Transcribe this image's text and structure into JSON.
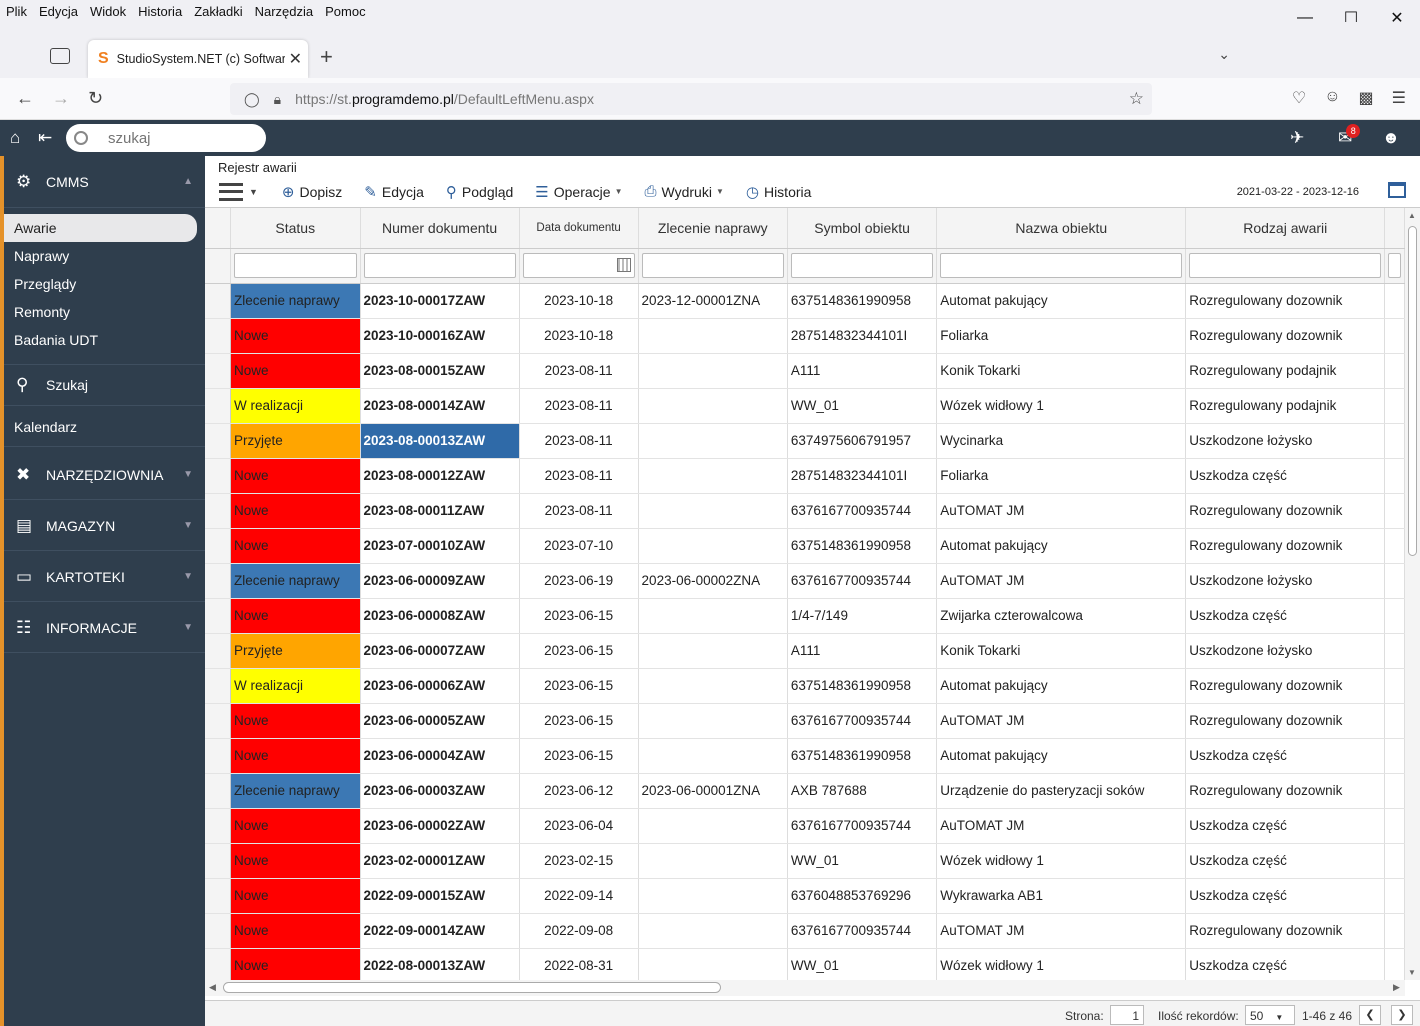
{
  "browser": {
    "menu": [
      "Plik",
      "Edycja",
      "Widok",
      "Historia",
      "Zakładki",
      "Narzędzia",
      "Pomoc"
    ],
    "tab_title": "StudioSystem.NET (c) Software",
    "url_prefix": "https://st.",
    "url_domain": "programdemo.pl",
    "url_path": "/DefaultLeftMenu.aspx"
  },
  "header": {
    "search_placeholder": "szukaj",
    "mail_count": "8"
  },
  "sidebar": {
    "cmms": "CMMS",
    "items": [
      "Awarie",
      "Naprawy",
      "Przeglądy",
      "Remonty",
      "Badania UDT"
    ],
    "szukaj": "Szukaj",
    "kalendarz": "Kalendarz",
    "narzedziownia": "NARZĘDZIOWNIA",
    "magazyn": "MAGAZYN",
    "kartoteki": "KARTOTEKI",
    "informacje": "INFORMACJE"
  },
  "main": {
    "breadcrumb": "Rejestr awarii",
    "toolbar": {
      "dopisz": "Dopisz",
      "edycja": "Edycja",
      "podglad": "Podgląd",
      "operacje": "Operacje",
      "wydruki": "Wydruki",
      "historia": "Historia"
    },
    "date_range": "2021-03-22 - 2023-12-16"
  },
  "grid": {
    "columns": [
      "Status",
      "Numer dokumentu",
      "Data dokumentu",
      "Zlecenie naprawy",
      "Symbol obiektu",
      "Nazwa obiektu",
      "Rodzaj awarii"
    ],
    "status_colors": {
      "Zlecenie naprawy": "#3c78b4",
      "Nowe": "#ff0000",
      "W realizacji": "#ffff00",
      "Przyjęte": "#ffa500"
    },
    "selected_cell_color": "#2f6aa8",
    "rows": [
      {
        "status": "Zlecenie naprawy",
        "doc": "2023-10-00017ZAW",
        "date": "2023-10-18",
        "order": "2023-12-00001ZNA",
        "symbol": "6375148361990958",
        "name": "Automat pakujący",
        "type": "Rozregulowany dozownik"
      },
      {
        "status": "Nowe",
        "doc": "2023-10-00016ZAW",
        "date": "2023-10-18",
        "order": "",
        "symbol": "287514832344101I",
        "name": "Foliarka",
        "type": "Rozregulowany dozownik"
      },
      {
        "status": "Nowe",
        "doc": "2023-08-00015ZAW",
        "date": "2023-08-11",
        "order": "",
        "symbol": "A111",
        "name": "Konik Tokarki",
        "type": "Rozregulowany podajnik"
      },
      {
        "status": "W realizacji",
        "doc": "2023-08-00014ZAW",
        "date": "2023-08-11",
        "order": "",
        "symbol": "WW_01",
        "name": "Wózek widłowy 1",
        "type": "Rozregulowany podajnik"
      },
      {
        "status": "Przyjęte",
        "doc": "2023-08-00013ZAW",
        "date": "2023-08-11",
        "order": "",
        "symbol": "6374975606791957",
        "name": "Wycinarka",
        "type": "Uszkodzone łożysko",
        "selected": true
      },
      {
        "status": "Nowe",
        "doc": "2023-08-00012ZAW",
        "date": "2023-08-11",
        "order": "",
        "symbol": "287514832344101I",
        "name": "Foliarka",
        "type": "Uszkodza część"
      },
      {
        "status": "Nowe",
        "doc": "2023-08-00011ZAW",
        "date": "2023-08-11",
        "order": "",
        "symbol": "6376167700935744",
        "name": "AuTOMAT JM",
        "type": "Rozregulowany dozownik"
      },
      {
        "status": "Nowe",
        "doc": "2023-07-00010ZAW",
        "date": "2023-07-10",
        "order": "",
        "symbol": "6375148361990958",
        "name": "Automat pakujący",
        "type": "Rozregulowany dozownik"
      },
      {
        "status": "Zlecenie naprawy",
        "doc": "2023-06-00009ZAW",
        "date": "2023-06-19",
        "order": "2023-06-00002ZNA",
        "symbol": "6376167700935744",
        "name": "AuTOMAT JM",
        "type": "Uszkodzone łożysko"
      },
      {
        "status": "Nowe",
        "doc": "2023-06-00008ZAW",
        "date": "2023-06-15",
        "order": "",
        "symbol": "1/4-7/149",
        "name": "Zwijarka czterowalcowa",
        "type": "Uszkodza część"
      },
      {
        "status": "Przyjęte",
        "doc": "2023-06-00007ZAW",
        "date": "2023-06-15",
        "order": "",
        "symbol": "A111",
        "name": "Konik Tokarki",
        "type": "Uszkodzone łożysko"
      },
      {
        "status": "W realizacji",
        "doc": "2023-06-00006ZAW",
        "date": "2023-06-15",
        "order": "",
        "symbol": "6375148361990958",
        "name": "Automat pakujący",
        "type": "Rozregulowany dozownik"
      },
      {
        "status": "Nowe",
        "doc": "2023-06-00005ZAW",
        "date": "2023-06-15",
        "order": "",
        "symbol": "6376167700935744",
        "name": "AuTOMAT JM",
        "type": "Rozregulowany dozownik"
      },
      {
        "status": "Nowe",
        "doc": "2023-06-00004ZAW",
        "date": "2023-06-15",
        "order": "",
        "symbol": "6375148361990958",
        "name": "Automat pakujący",
        "type": "Uszkodza część"
      },
      {
        "status": "Zlecenie naprawy",
        "doc": "2023-06-00003ZAW",
        "date": "2023-06-12",
        "order": "2023-06-00001ZNA",
        "symbol": "AXB 787688",
        "name": "Urządzenie do pasteryzacji soków",
        "type": "Rozregulowany dozownik"
      },
      {
        "status": "Nowe",
        "doc": "2023-06-00002ZAW",
        "date": "2023-06-04",
        "order": "",
        "symbol": "6376167700935744",
        "name": "AuTOMAT JM",
        "type": "Uszkodza część"
      },
      {
        "status": "Nowe",
        "doc": "2023-02-00001ZAW",
        "date": "2023-02-15",
        "order": "",
        "symbol": "WW_01",
        "name": "Wózek widłowy 1",
        "type": "Uszkodza część"
      },
      {
        "status": "Nowe",
        "doc": "2022-09-00015ZAW",
        "date": "2022-09-14",
        "order": "",
        "symbol": "6376048853769296",
        "name": "Wykrawarka AB1",
        "type": "Uszkodza część"
      },
      {
        "status": "Nowe",
        "doc": "2022-09-00014ZAW",
        "date": "2022-09-08",
        "order": "",
        "symbol": "6376167700935744",
        "name": "AuTOMAT JM",
        "type": "Rozregulowany dozownik"
      },
      {
        "status": "Nowe",
        "doc": "2022-08-00013ZAW",
        "date": "2022-08-31",
        "order": "",
        "symbol": "WW_01",
        "name": "Wózek widłowy 1",
        "type": "Uszkodza część"
      }
    ]
  },
  "pager": {
    "page_label": "Strona:",
    "page": "1",
    "records_label": "Ilość rekordów:",
    "records": "50",
    "range": "1-46 z 46"
  }
}
